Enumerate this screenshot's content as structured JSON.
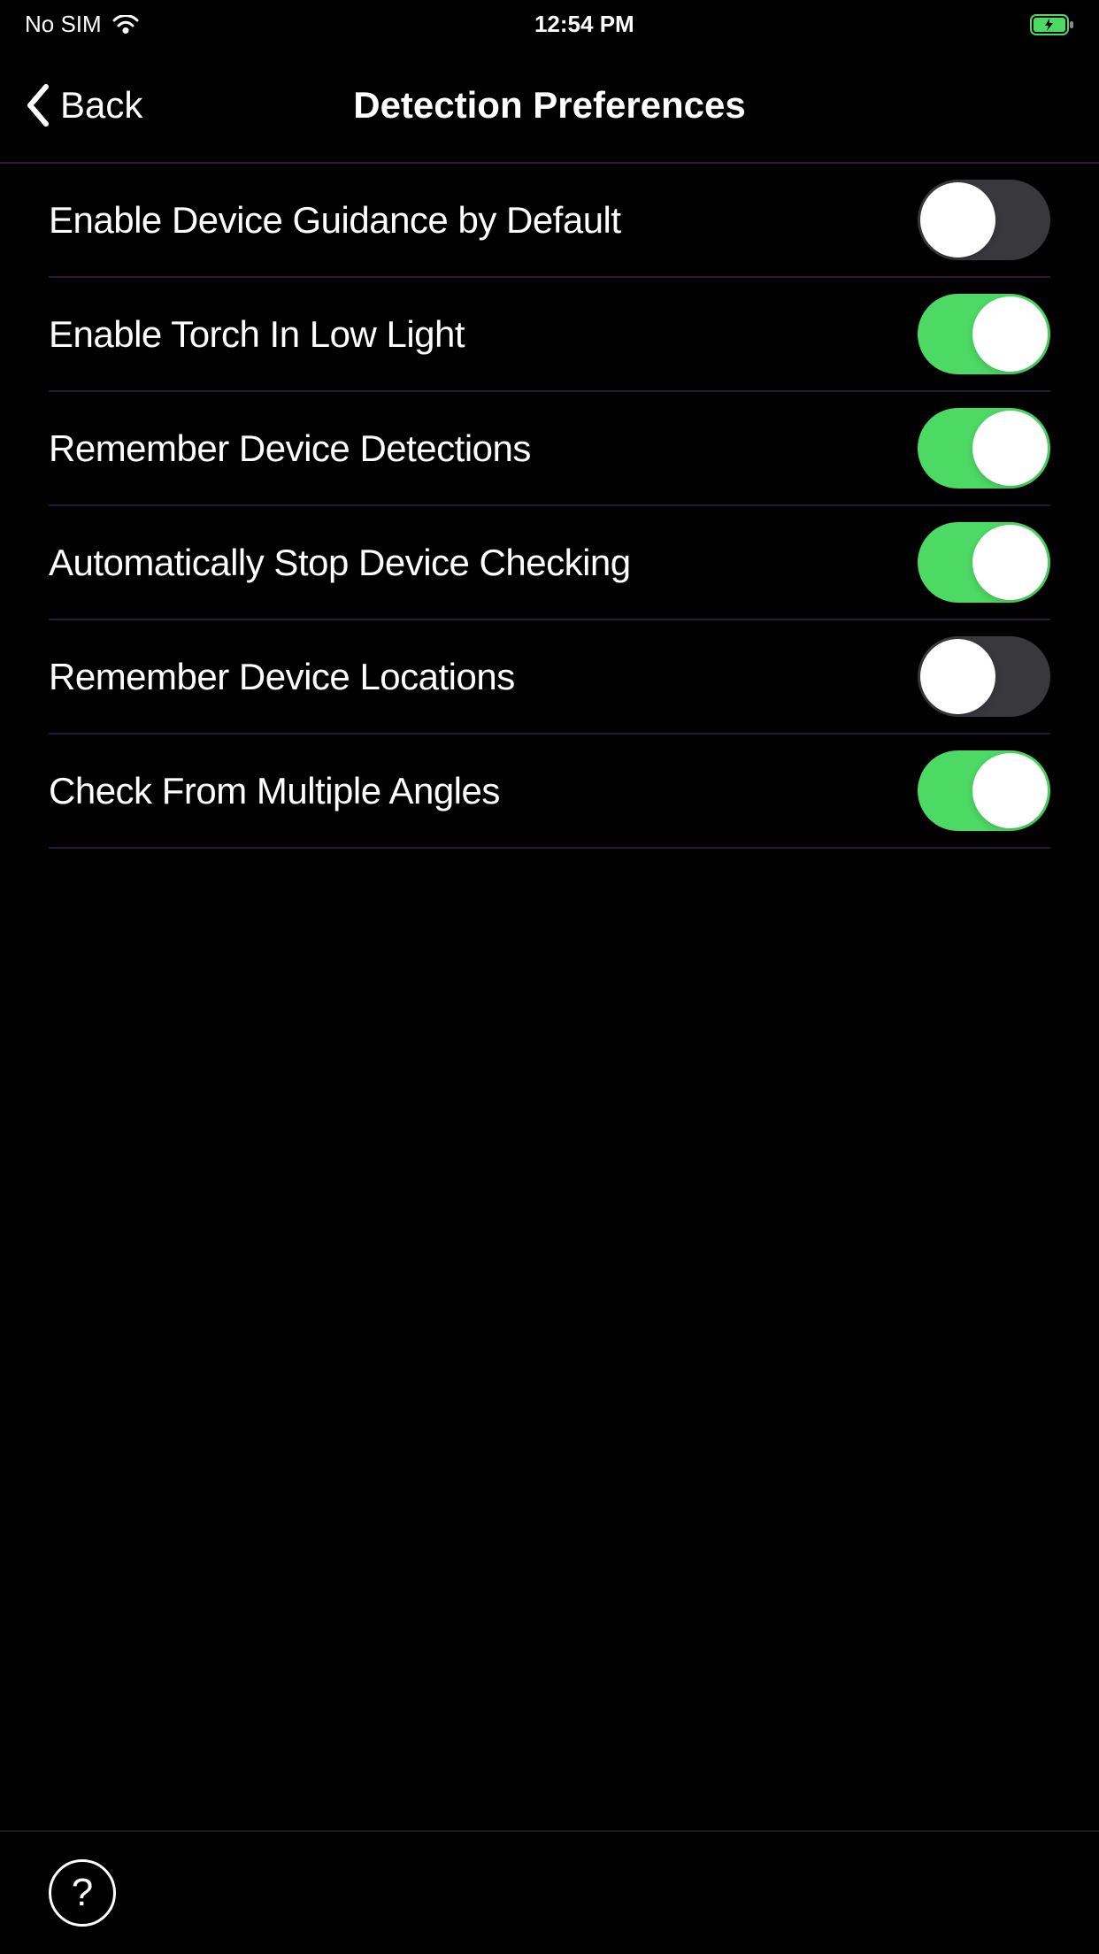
{
  "statusBar": {
    "carrier": "No SIM",
    "time": "12:54 PM"
  },
  "nav": {
    "backLabel": "Back",
    "title": "Detection Preferences"
  },
  "settings": [
    {
      "label": "Enable Device Guidance by Default",
      "enabled": false
    },
    {
      "label": "Enable Torch In Low Light",
      "enabled": true
    },
    {
      "label": "Remember Device Detections",
      "enabled": true
    },
    {
      "label": "Automatically Stop Device Checking",
      "enabled": true
    },
    {
      "label": "Remember Device Locations",
      "enabled": false
    },
    {
      "label": "Check From Multiple Angles",
      "enabled": true
    }
  ],
  "footer": {
    "helpLabel": "?"
  }
}
